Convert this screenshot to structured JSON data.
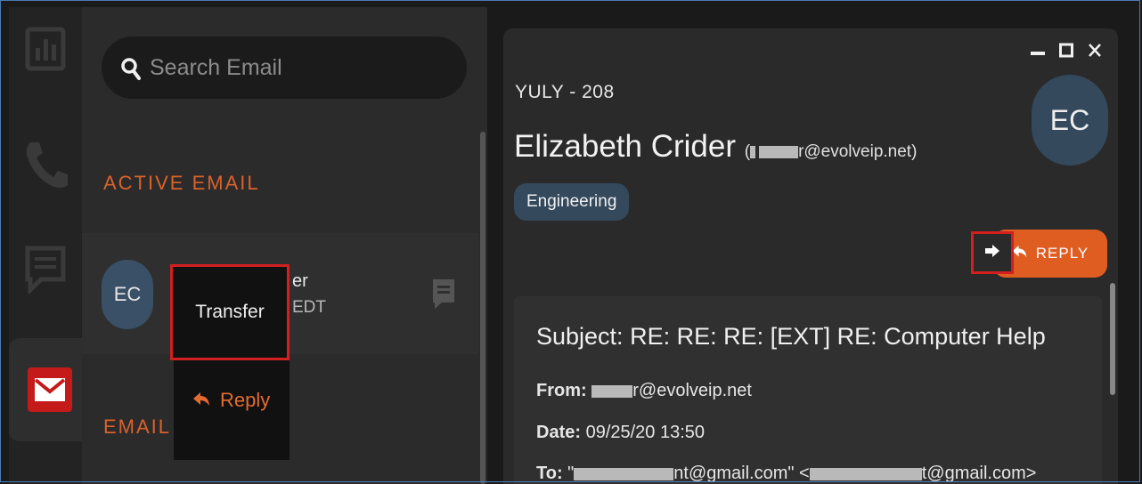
{
  "rail": {
    "icons": [
      "stats-icon",
      "phone-icon",
      "chat-icon",
      "mail-icon"
    ],
    "active": "mail-icon"
  },
  "list": {
    "search_placeholder": "Search Email",
    "section_active": "ACTIVE EMAIL",
    "section_email": "EMAIL",
    "active_item": {
      "avatar": "EC",
      "name_fragment": "er",
      "time_fragment": "EDT"
    }
  },
  "context_menu": {
    "transfer": "Transfer",
    "reply": "Reply"
  },
  "detail": {
    "window_controls": [
      "–",
      "□",
      "✕"
    ],
    "ticket": "YULY - 208",
    "sender_name": "Elizabeth Crider",
    "sender_email_suffix": "r@evolveip.net",
    "tag": "Engineering",
    "avatar": "EC",
    "reply_button": "REPLY",
    "subject_label": "Subject:",
    "subject": "RE: RE: RE: [EXT] RE: Computer Help",
    "from_label": "From:",
    "from_suffix": "r@evolveip.net",
    "date_label": "Date:",
    "date": "09/25/20 13:50",
    "to_label": "To:",
    "to_prefix": "\"",
    "to_mid": "nt@gmail.com\" <",
    "to_suffix": "t@gmail.com>"
  },
  "colors": {
    "accent": "#e05d22",
    "highlight": "#d21f1f",
    "avatar_bg": "#34495c"
  }
}
